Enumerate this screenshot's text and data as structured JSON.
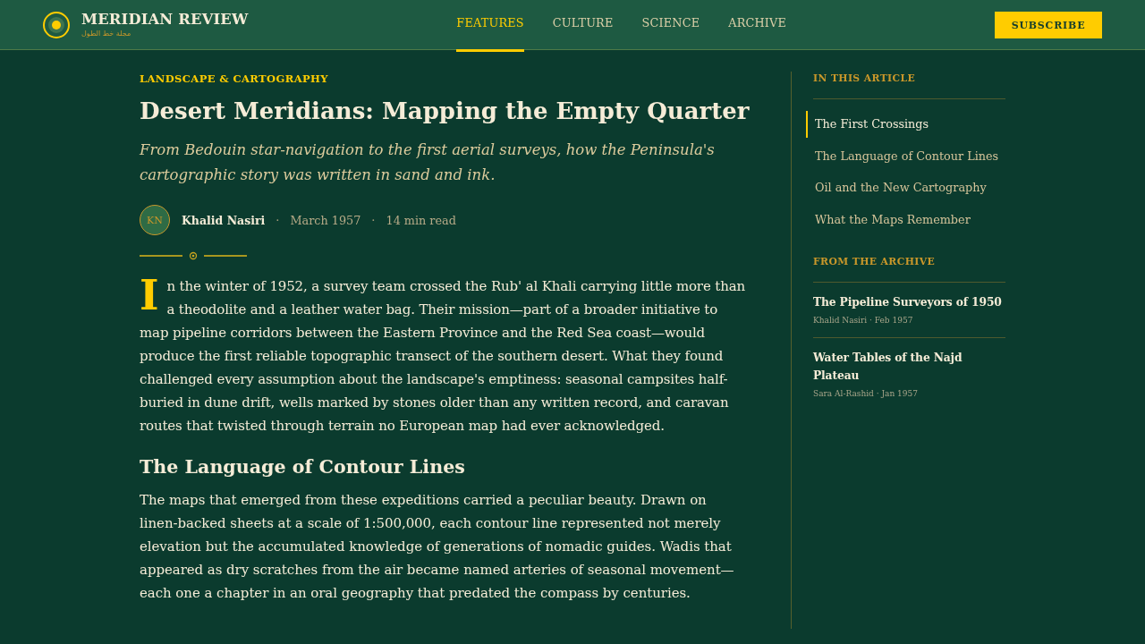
{
  "header": {
    "brand": {
      "name": "MERIDIAN REVIEW",
      "tagline": "مجلة خط الطول"
    },
    "nav": [
      {
        "label": "FEATURES",
        "selected": true
      },
      {
        "label": "CULTURE",
        "selected": false
      },
      {
        "label": "SCIENCE",
        "selected": false
      },
      {
        "label": "ARCHIVE",
        "selected": false
      }
    ],
    "subscribe_button": "SUBSCRIBE"
  },
  "article": {
    "kicker": "LANDSCAPE & CARTOGRAPHY",
    "title": "Desert Meridians: Mapping the Empty Quarter",
    "dek": "From Bedouin star-navigation to the first aerial surveys, how the Peninsula's cartographic story was written in sand and ink.",
    "byline": {
      "initials": "KN",
      "author": "Khalid Nasiri",
      "meta": [
        {
          "separator": "·",
          "text": "March 1957"
        },
        {
          "separator": "·",
          "text": "14 min read"
        }
      ]
    },
    "body": [
      {
        "kind": "paragraph",
        "drop_cap": true,
        "text": "In the winter of 1952, a survey team crossed the Rub' al Khali carrying little more than a theodolite and a leather water bag. Their mission—part of a broader initiative to map pipeline corridors between the Eastern Province and the Red Sea coast—would produce the first reliable topographic transect of the southern desert. What they found challenged every assumption about the landscape's emptiness: seasonal campsites half-buried in dune drift, wells marked by stones older than any written record, and caravan routes that twisted through terrain no European map had ever acknowledged."
      },
      {
        "kind": "heading",
        "text": "The Language of Contour Lines"
      },
      {
        "kind": "paragraph",
        "drop_cap": false,
        "text": "The maps that emerged from these expeditions carried a peculiar beauty. Drawn on linen-backed sheets at a scale of 1:500,000, each contour line represented not merely elevation but the accumulated knowledge of generations of nomadic guides. Wadis that appeared as dry scratches from the air became named arteries of seasonal movement—each one a chapter in an oral geography that predated the compass by centuries."
      }
    ]
  },
  "sidebar": {
    "toc": {
      "heading": "IN THIS ARTICLE",
      "items": [
        {
          "label": "The First Crossings",
          "selected": true
        },
        {
          "label": "The Language of Contour Lines",
          "selected": false
        },
        {
          "label": "Oil and the New Cartography",
          "selected": false
        },
        {
          "label": "What the Maps Remember",
          "selected": false
        }
      ]
    },
    "archive": {
      "heading": "FROM THE ARCHIVE",
      "items": [
        {
          "title": "The Pipeline Surveyors of 1950",
          "meta": "Khalid Nasiri · Feb 1957"
        },
        {
          "title": "Water Tables of the Najd Plateau",
          "meta": "Sara Al-Rashid · Jan 1957"
        }
      ]
    }
  }
}
